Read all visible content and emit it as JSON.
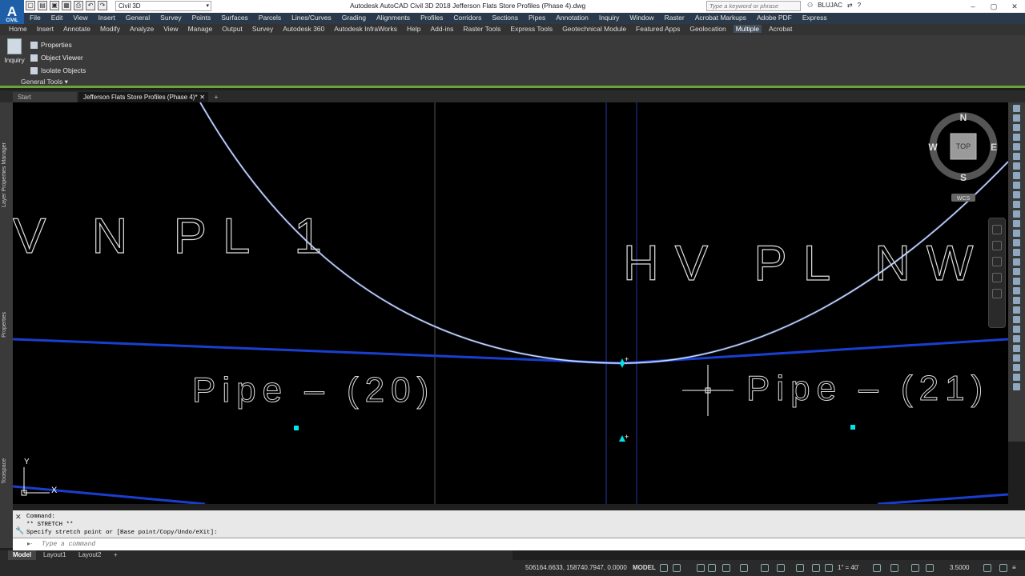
{
  "app": {
    "logo_text": "A",
    "logo_sub": "CIVIL",
    "window_title": "Autodesk AutoCAD Civil 3D 2018   Jefferson Flats Store Profiles (Phase 4).dwg",
    "workspace": "Civil 3D",
    "search_placeholder": "Type a keyword or phrase",
    "user": "BLUJAC"
  },
  "menubar": [
    "File",
    "Edit",
    "View",
    "Insert",
    "General",
    "Survey",
    "Points",
    "Surfaces",
    "Parcels",
    "Lines/Curves",
    "Grading",
    "Alignments",
    "Profiles",
    "Corridors",
    "Sections",
    "Pipes",
    "Annotation",
    "Inquiry",
    "Window",
    "Raster",
    "Acrobat Markups",
    "Adobe PDF",
    "Express"
  ],
  "ribbon_tabs": [
    "Home",
    "Insert",
    "Annotate",
    "Modify",
    "Analyze",
    "View",
    "Manage",
    "Output",
    "Survey",
    "Autodesk 360",
    "Autodesk InfraWorks",
    "Help",
    "Add-ins",
    "Raster Tools",
    "Express Tools",
    "Geotechnical Module",
    "Featured Apps",
    "Geolocation",
    "Multiple",
    "Acrobat"
  ],
  "active_ribbon_tab": "Multiple",
  "ribbon_panel": {
    "inquiry_label": "Inquiry",
    "tools": [
      "Properties",
      "Object Viewer",
      "Isolate Objects"
    ],
    "panel_title": "General Tools"
  },
  "file_tabs": {
    "start": "Start",
    "drawing": "Jefferson Flats Store Profiles (Phase 4)*",
    "plus": "+"
  },
  "palettes": {
    "layer_manager": "Layer Properties Manager",
    "properties": "Properties",
    "toolspace": "Toolspace"
  },
  "viewcube": {
    "north": "N",
    "south": "S",
    "east": "E",
    "west": "W",
    "face": "TOP",
    "wcs": "WCS"
  },
  "drawing_text": {
    "left_label": "V N PL 1",
    "right_label": "HV PL NW",
    "pipe_left": "Pipe – (20)",
    "pipe_right": "Pipe – (21)",
    "ucs_x": "X",
    "ucs_y": "Y"
  },
  "command": {
    "history": [
      "Command:",
      "** STRETCH **",
      "Specify stretch point or [Base point/Copy/Undo/eXit]:"
    ],
    "placeholder": "Type a command"
  },
  "layout_tabs": [
    "Model",
    "Layout1",
    "Layout2"
  ],
  "status": {
    "coordinates": "506164.6633, 158740.7947, 0.0000",
    "model": "MODEL",
    "scale": "1\" = 40'",
    "value": "3.5000"
  },
  "colors": {
    "accent": "#6ba33a",
    "pipe_line": "#1a3fd0",
    "curve": "#ffffff",
    "grip": "#00e5e5"
  }
}
